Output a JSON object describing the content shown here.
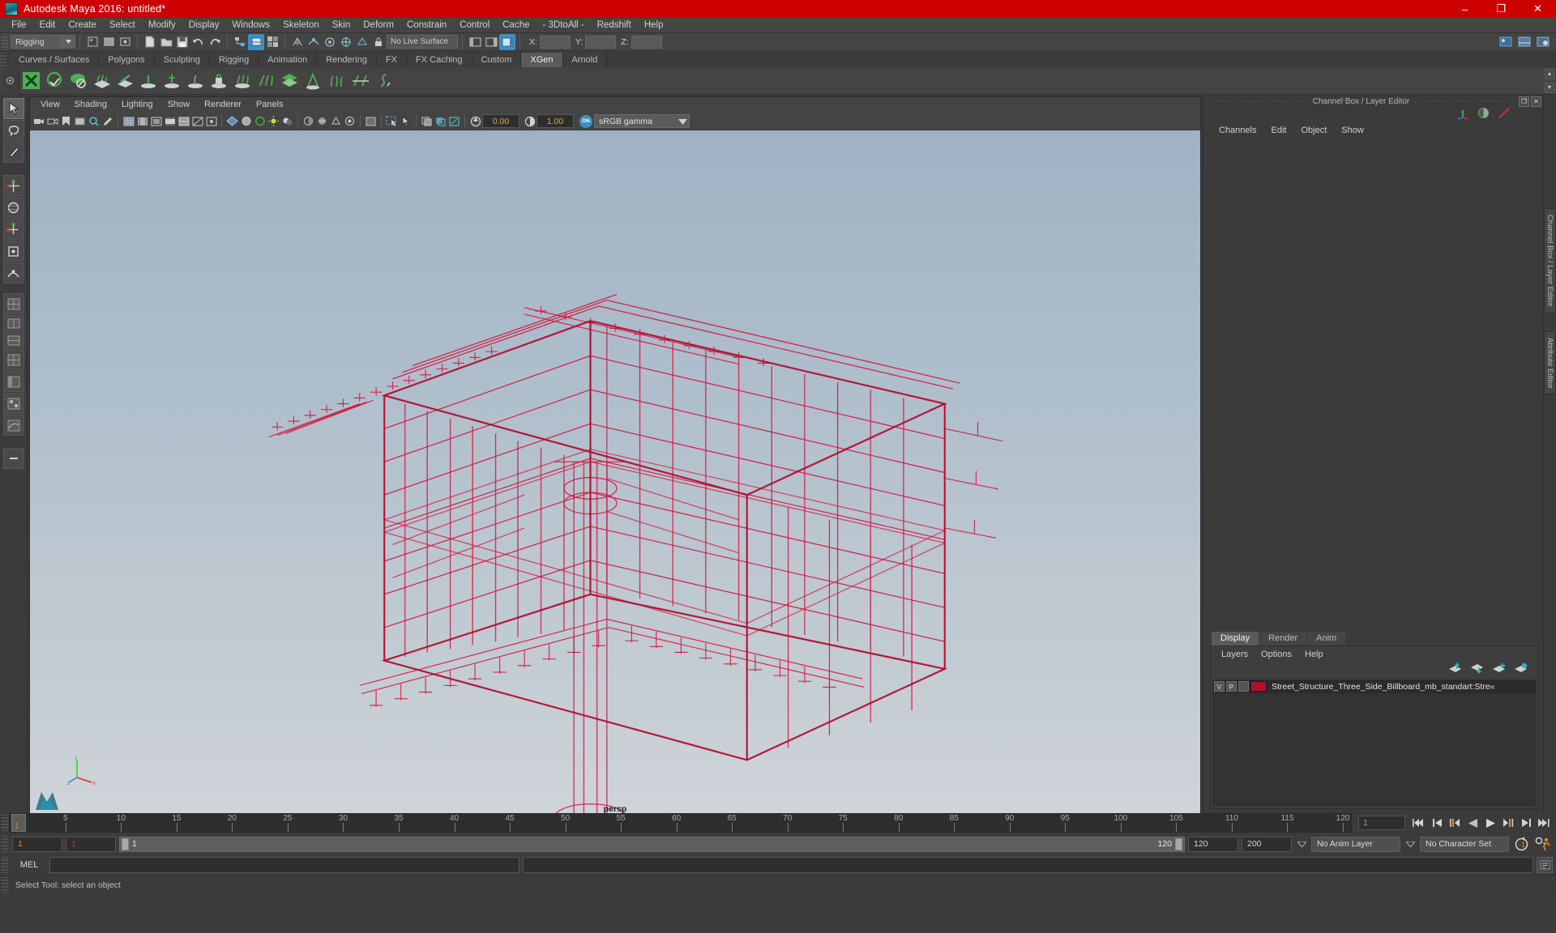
{
  "window": {
    "title": "Autodesk Maya 2016: untitled*",
    "minimize": "–",
    "maximize": "❐",
    "close": "✕",
    "title_bg": "#cc0000"
  },
  "menubar": {
    "items": [
      {
        "label": "File"
      },
      {
        "label": "Edit"
      },
      {
        "label": "Create"
      },
      {
        "label": "Select"
      },
      {
        "label": "Modify"
      },
      {
        "label": "Display"
      },
      {
        "label": "Windows"
      },
      {
        "label": "Skeleton"
      },
      {
        "label": "Skin"
      },
      {
        "label": "Deform"
      },
      {
        "label": "Constrain"
      },
      {
        "label": "Control"
      },
      {
        "label": "Cache"
      },
      {
        "label": "- 3DtoAll -"
      },
      {
        "label": "Redshift"
      },
      {
        "label": "Help"
      }
    ]
  },
  "statusline": {
    "menu_set": "Rigging",
    "live_surface": "No Live Surface",
    "coord_x_label": "X:",
    "coord_y_label": "Y:",
    "coord_z_label": "Z:",
    "coord_x_value": "",
    "coord_y_value": "",
    "coord_z_value": ""
  },
  "shelf": {
    "tabs": [
      {
        "label": "Curves / Surfaces",
        "active": false
      },
      {
        "label": "Polygons",
        "active": false
      },
      {
        "label": "Sculpting",
        "active": false
      },
      {
        "label": "Rigging",
        "active": false
      },
      {
        "label": "Animation",
        "active": false
      },
      {
        "label": "Rendering",
        "active": false
      },
      {
        "label": "FX",
        "active": false
      },
      {
        "label": "FX Caching",
        "active": false
      },
      {
        "label": "Custom",
        "active": false
      },
      {
        "label": "XGen",
        "active": true
      },
      {
        "label": "Arnold",
        "active": false
      }
    ],
    "scroll_up": "▲",
    "scroll_down": "▼"
  },
  "viewport": {
    "menus": [
      {
        "label": "View"
      },
      {
        "label": "Shading"
      },
      {
        "label": "Lighting"
      },
      {
        "label": "Show"
      },
      {
        "label": "Renderer"
      },
      {
        "label": "Panels"
      }
    ],
    "exposure_value": "0.00",
    "gamma_value": "1.00",
    "color_toggle": "ON",
    "color_profile": "sRGB gamma",
    "camera_label": "persp",
    "model_color": "#d6113a",
    "axis_x": "x",
    "axis_y": "y",
    "axis_z": "z"
  },
  "channelbox": {
    "panel_title": "Channel Box / Layer Editor",
    "undock_glyph": "❐",
    "close_glyph": "✕",
    "menus": [
      {
        "label": "Channels"
      },
      {
        "label": "Edit"
      },
      {
        "label": "Object"
      },
      {
        "label": "Show"
      }
    ]
  },
  "vtabs": [
    {
      "label": "Channel Box / Layer Editor"
    },
    {
      "label": "Attribute Editor"
    }
  ],
  "layer_editor": {
    "tabs": [
      {
        "label": "Display",
        "active": true
      },
      {
        "label": "Render",
        "active": false
      },
      {
        "label": "Anim",
        "active": false
      }
    ],
    "menus": [
      {
        "label": "Layers"
      },
      {
        "label": "Options"
      },
      {
        "label": "Help"
      }
    ],
    "layers": [
      {
        "visibility": "V",
        "playback": "P",
        "shading": "",
        "color": "#b0122e",
        "name": "Street_Structure_Three_Side_Billboard_mb_standart:Stre«"
      }
    ]
  },
  "timeline": {
    "ticks": [
      {
        "value": "",
        "frame": 1
      },
      {
        "value": "5",
        "frame": 5
      },
      {
        "value": "10",
        "frame": 10
      },
      {
        "value": "15",
        "frame": 15
      },
      {
        "value": "20",
        "frame": 20
      },
      {
        "value": "25",
        "frame": 25
      },
      {
        "value": "30",
        "frame": 30
      },
      {
        "value": "35",
        "frame": 35
      },
      {
        "value": "40",
        "frame": 40
      },
      {
        "value": "45",
        "frame": 45
      },
      {
        "value": "50",
        "frame": 50
      },
      {
        "value": "55",
        "frame": 55
      },
      {
        "value": "60",
        "frame": 60
      },
      {
        "value": "65",
        "frame": 65
      },
      {
        "value": "70",
        "frame": 70
      },
      {
        "value": "75",
        "frame": 75
      },
      {
        "value": "80",
        "frame": 80
      },
      {
        "value": "85",
        "frame": 85
      },
      {
        "value": "90",
        "frame": 90
      },
      {
        "value": "95",
        "frame": 95
      },
      {
        "value": "100",
        "frame": 100
      },
      {
        "value": "105",
        "frame": 105
      },
      {
        "value": "110",
        "frame": 110
      },
      {
        "value": "115",
        "frame": 115
      },
      {
        "value": "120",
        "frame": 120
      }
    ],
    "range_start": 1,
    "range_end": 120,
    "current_frame": "1",
    "current_frame_field": "1"
  },
  "range": {
    "anim_start": "1",
    "playback_start": "1",
    "bar_start_label": "1",
    "bar_end_label": "120",
    "playback_end": "120",
    "anim_end": "200",
    "anim_layer": "No Anim Layer",
    "character_set": "No Character Set"
  },
  "mel": {
    "label": "MEL",
    "input_value": "",
    "output_value": ""
  },
  "helpline": {
    "text": "Select Tool: select an object"
  }
}
